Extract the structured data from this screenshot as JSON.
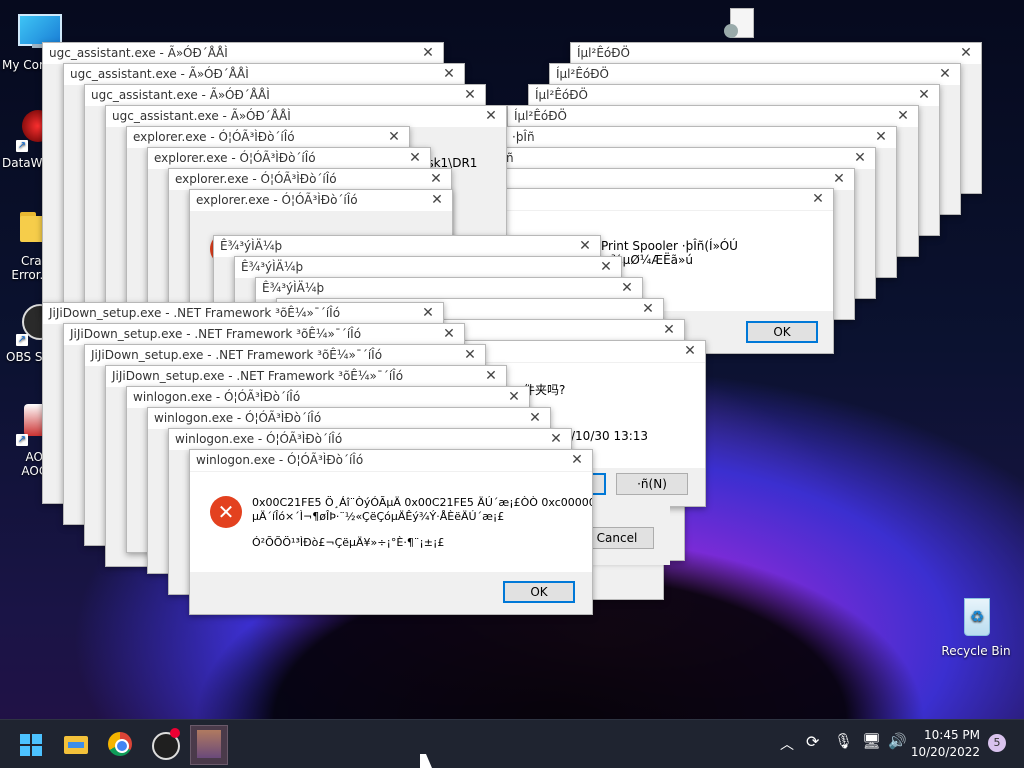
{
  "desktop": {
    "icons": [
      {
        "label": "My Com"
      },
      {
        "label": "DataWa"
      },
      {
        "label": "Crazy\nError.exe"
      },
      {
        "label": "OBS St"
      },
      {
        "label": "AOp\nAOCo"
      },
      {
        "label": "Recycle Bin"
      }
    ]
  },
  "windows": {
    "ugc_title": "ugc_assistant.exe - Ã»ÓÐ´ÅÅÌ",
    "explorer_title": "explorer.exe - Ó¦ÓÃ³ÌÐò´íÎó",
    "jiji_title": "JiJiDown_setup.exe - .NET Framework ³õÊ¼»¯´íÎó",
    "winlogon_title": "winlogon.exe - Ó¦ÓÃ³ÌÐò´íÎó",
    "system_title": "Ê¾³ýÌÄ¼þ",
    "print_title": "Íµl²ÊóÐÖ",
    "print_sub_title": "·þÎñ",
    "print_spooler_text": "Print Spooler ·þÎñ(Í»ÓÚ ±¾µØ¼ÆËã»ú",
    "disk_path_text": "isk1\\DR1",
    "chinese_question": "件夹吗?",
    "date_text": "/10/30 13:13",
    "ok_label": "OK",
    "cancel_label": "Cancel",
    "no_label": "·ñ(N)"
  },
  "main_error": {
    "title": "winlogon.exe - Ó¦ÓÃ³ÌÐò´íÎó",
    "line1": "0x00C21FE5 Ö¸Áî¨ÒýÓÃµÄ 0x00C21FE5 ÄÚ´æ¡£ÒÒ 0xc000000e",
    "line2": "µÄ´íÎó×´Ì¬¶øÎÞ·¨½«ÇëÇóµÄÊý¾Ý·ÅÈëÄÚ´æ¡£",
    "line3": "Ó²ÕÕÖ¹³ÌÐò£¬ÇëµÄ¥»÷¡°È·¶¨¡±¡£",
    "ok_label": "OK",
    "icon": "error-x-icon"
  },
  "taskbar": {
    "time": "10:45 PM",
    "date": "10/20/2022",
    "notification_count": "5",
    "apps": [
      "start-icon",
      "file-explorer-icon",
      "chrome-icon",
      "obs-icon",
      "anime-app-icon"
    ]
  }
}
